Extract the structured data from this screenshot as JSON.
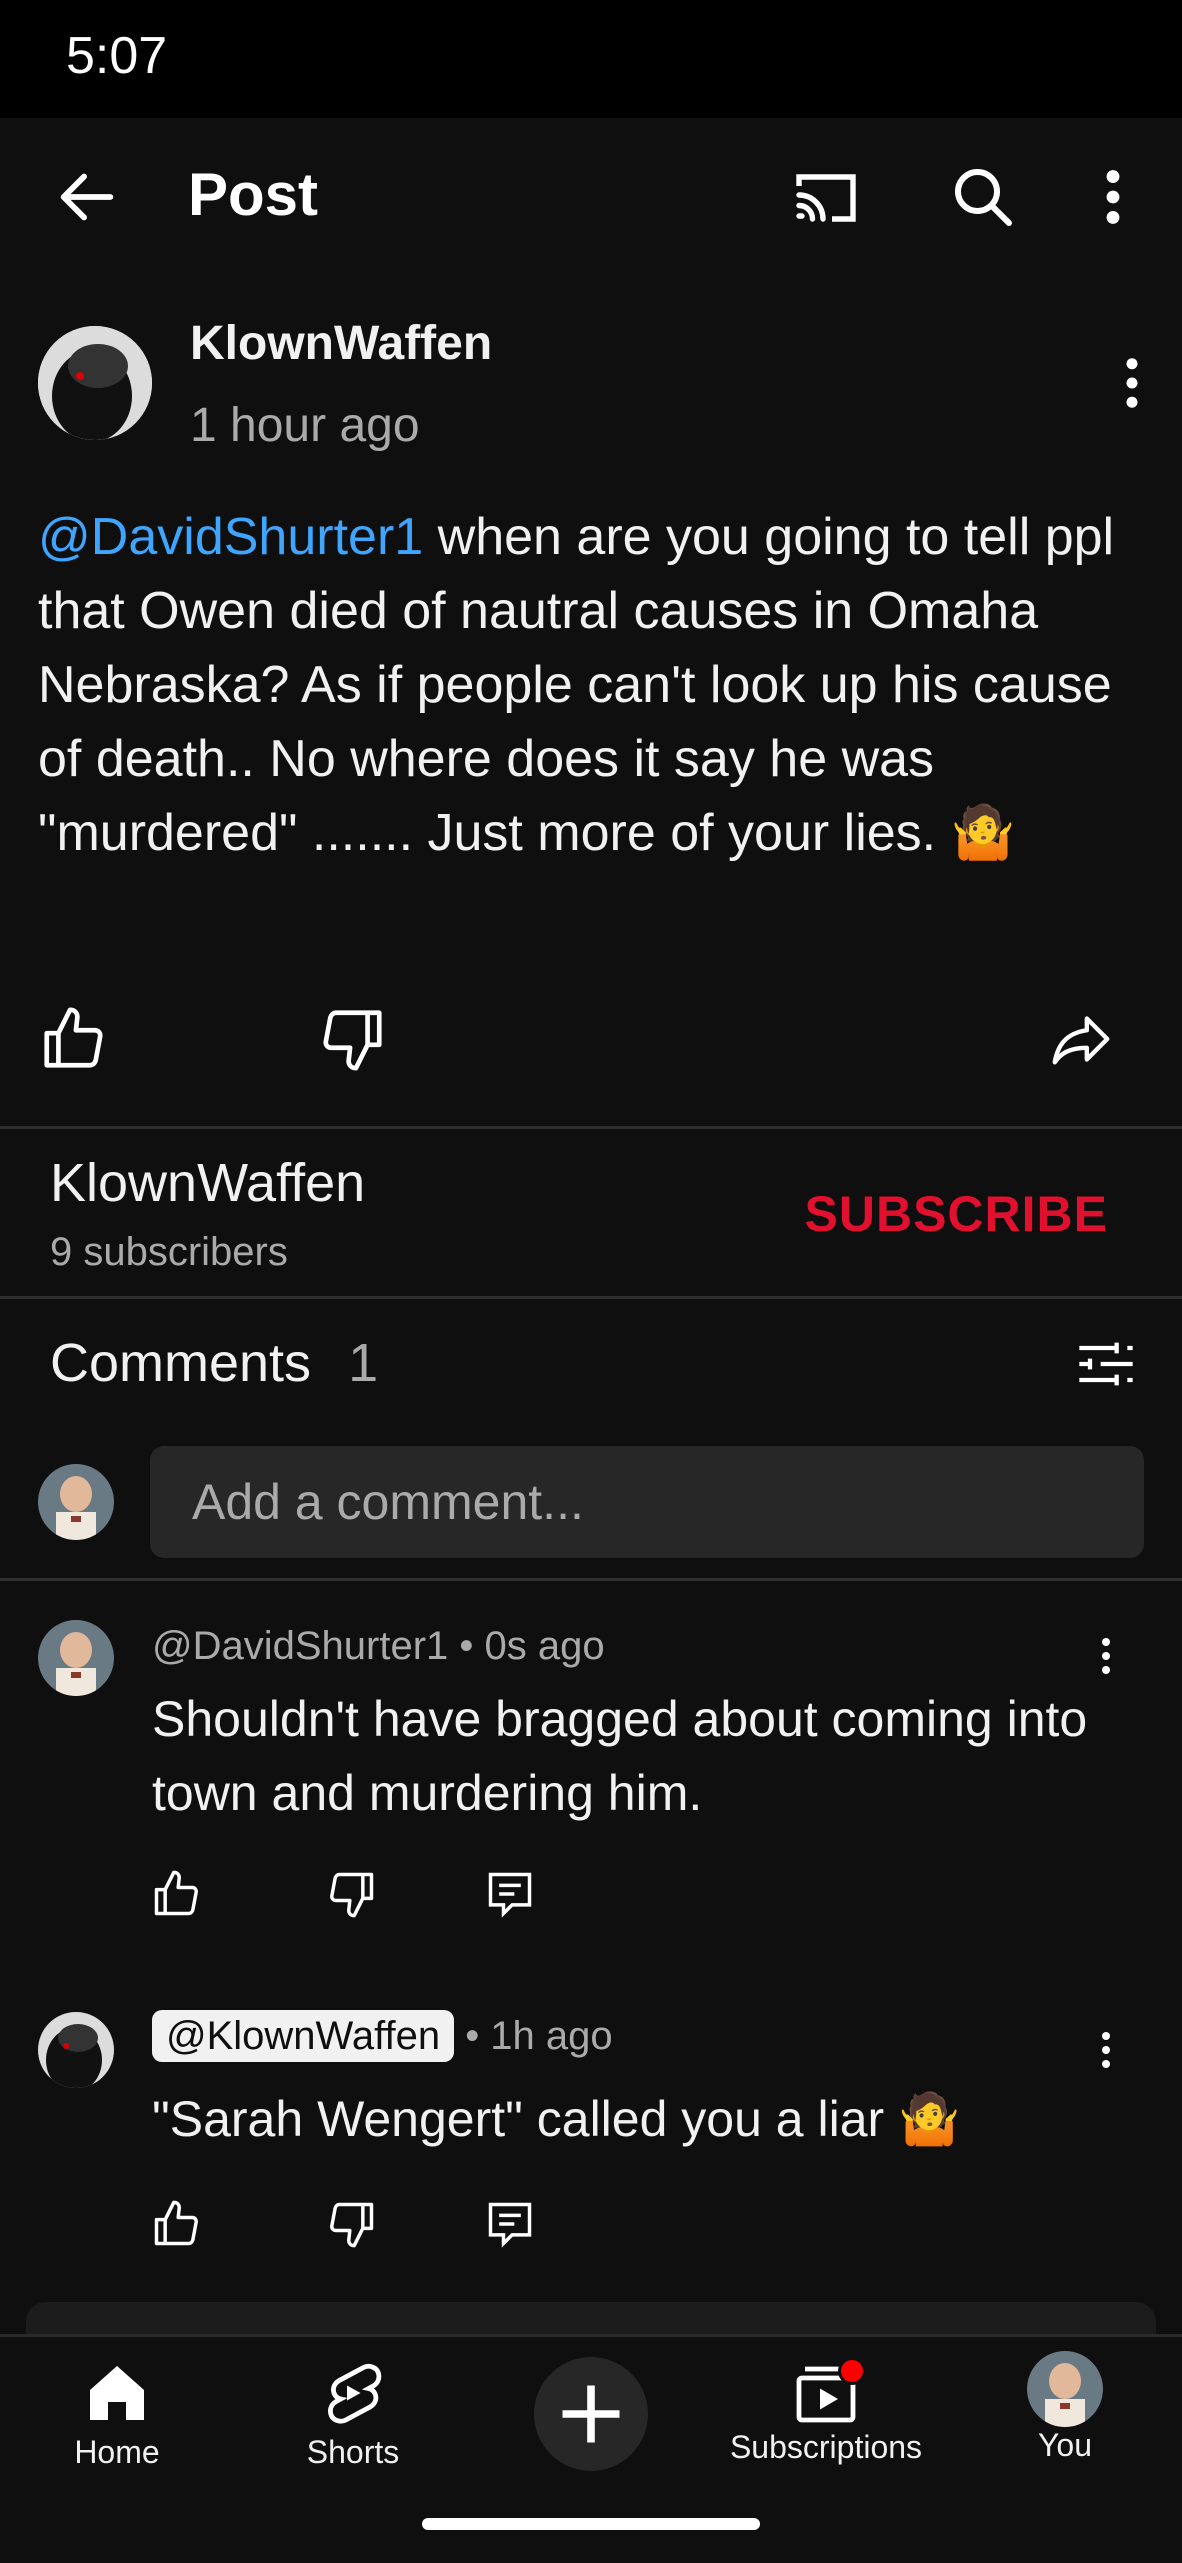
{
  "status": {
    "time": "5:07"
  },
  "appbar": {
    "title": "Post",
    "icons": [
      "back-arrow-icon",
      "cast-icon",
      "search-icon",
      "more-vert-icon"
    ]
  },
  "post": {
    "author": "KlownWaffen",
    "time": "1 hour ago",
    "mention": "@DavidShurter1",
    "body": " when are you going to tell ppl that Owen died of nautral causes in Omaha Nebraska? As if people can't look up his cause of death.. No where does it say he was \"murdered\" ....... Just more of your lies. 🤷"
  },
  "channel": {
    "name": "KlownWaffen",
    "subscribers": "9 subscribers",
    "subscribe_label": "SUBSCRIBE"
  },
  "comments": {
    "label": "Comments",
    "count": "1",
    "placeholder": "Add a comment...",
    "items": [
      {
        "author": "@DavidShurter1",
        "time": "• 0s ago",
        "text": "Shouldn't have bragged about coming into town and murdering him."
      },
      {
        "author": "@KlownWaffen",
        "time": "• 1h ago",
        "text": "\"Sarah Wengert\" called you a liar 🤷"
      }
    ]
  },
  "nav": {
    "home": "Home",
    "shorts": "Shorts",
    "subscriptions": "Subscriptions",
    "you": "You"
  },
  "colors": {
    "background": "#0f0f0f",
    "mention": "#3ea6ff",
    "subscribe": "#e0102e",
    "notification_dot": "#ff0000"
  }
}
